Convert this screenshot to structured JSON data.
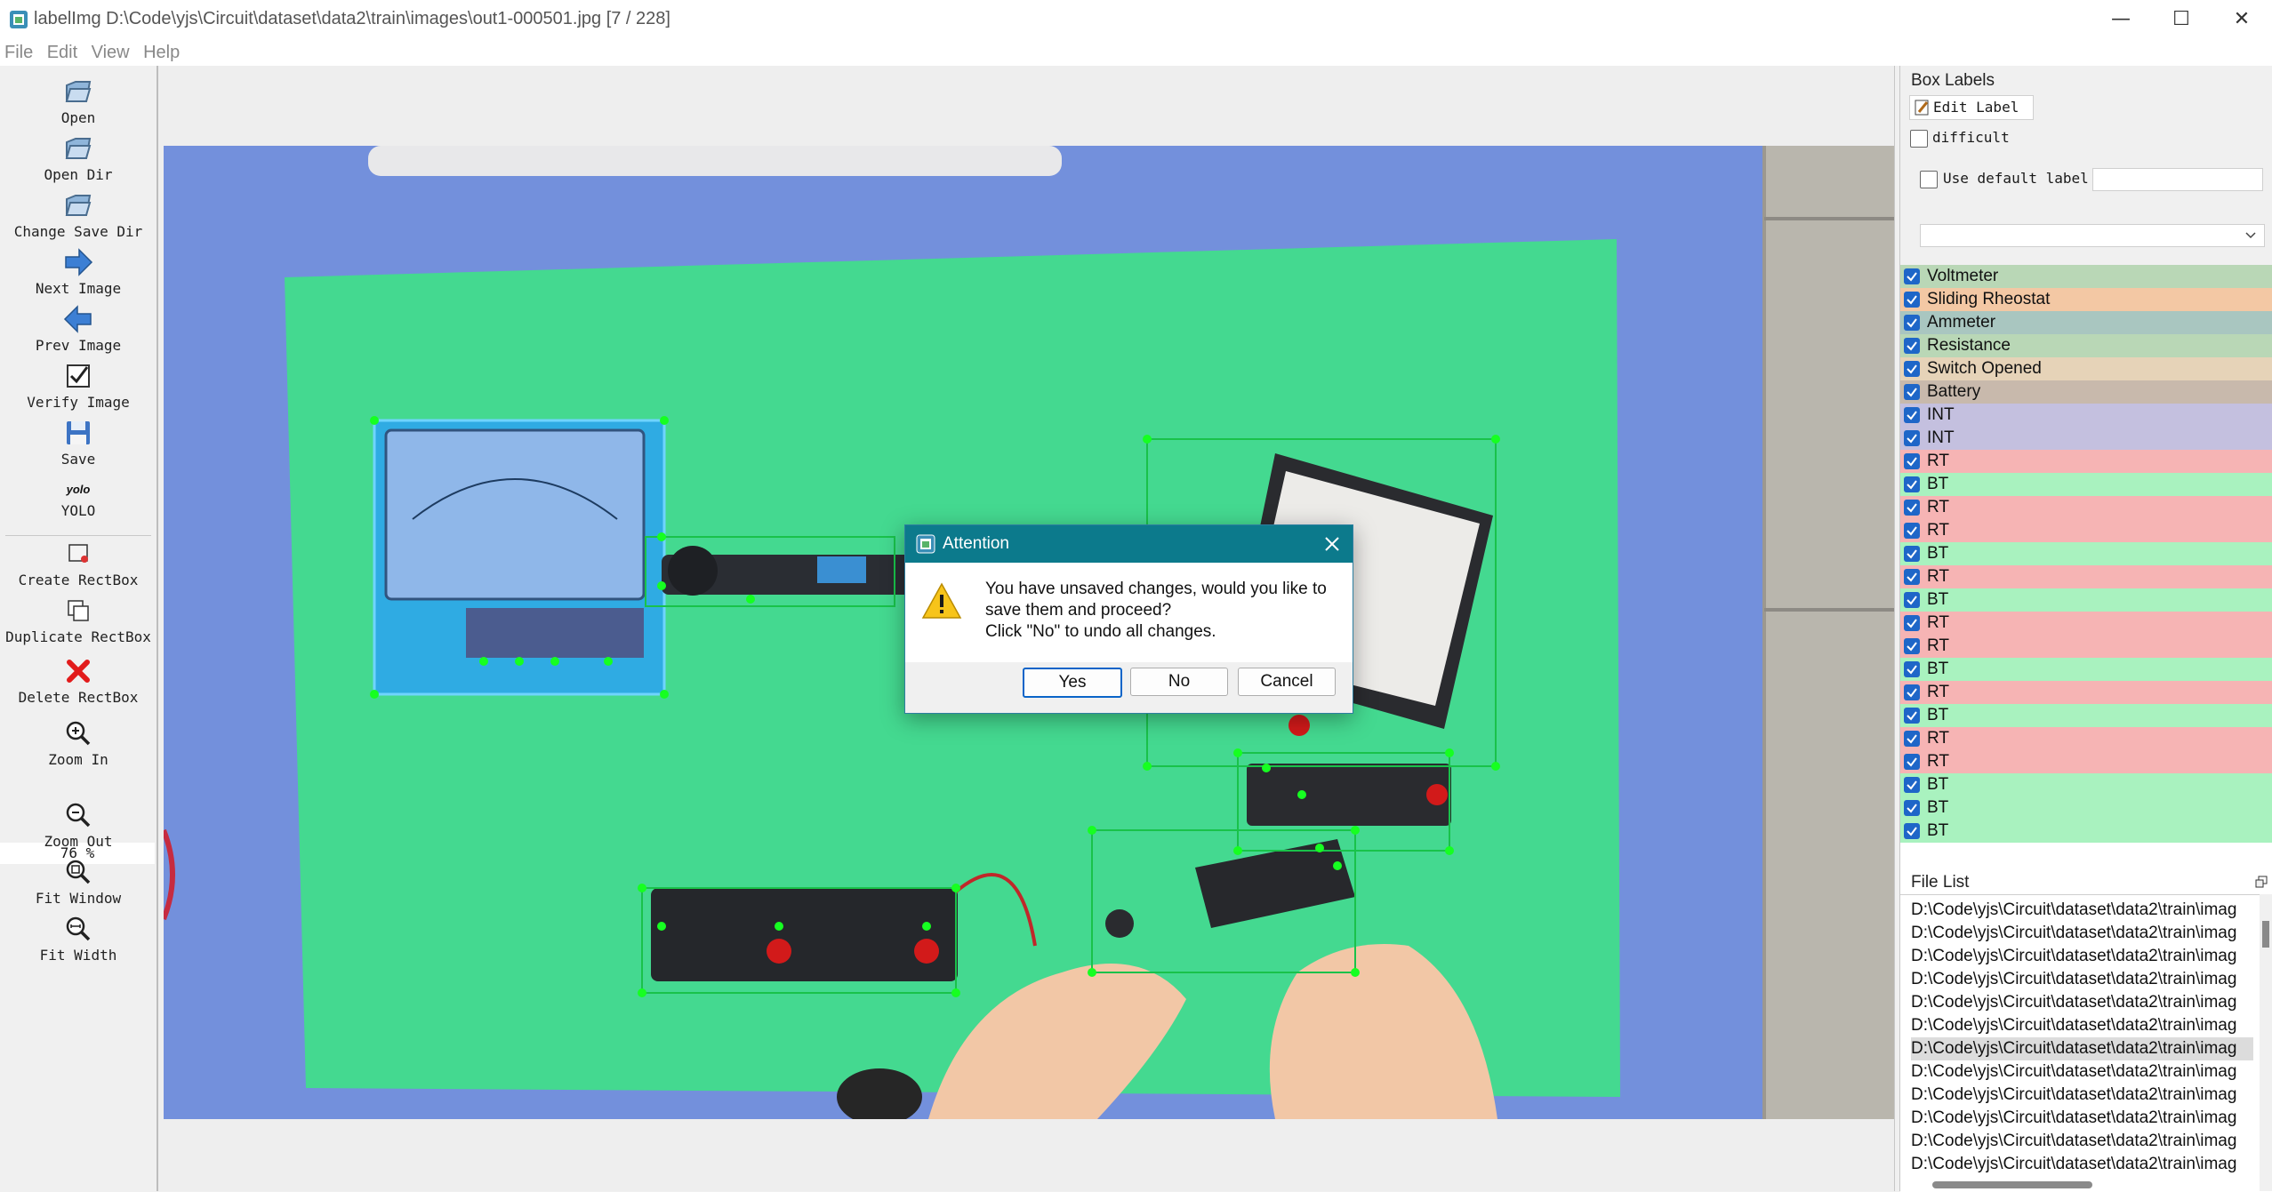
{
  "window": {
    "title": "labelImg D:\\Code\\yjs\\Circuit\\dataset\\data2\\train\\images\\out1-000501.jpg [7 / 228]",
    "minimize": "—",
    "maximize": "☐",
    "close": "✕"
  },
  "menu": [
    "File",
    "Edit",
    "View",
    "Help"
  ],
  "toolbar": {
    "open": "Open",
    "open_dir": "Open Dir",
    "change_save_dir": "Change Save Dir",
    "next_image": "Next Image",
    "prev_image": "Prev Image",
    "verify_image": "Verify Image",
    "save": "Save",
    "yolo_icon_text": "yolo",
    "yolo": "YOLO",
    "create_rectbox": "Create RectBox",
    "duplicate_rectbox": "Duplicate RectBox",
    "delete_rectbox": "Delete RectBox",
    "zoom_in": "Zoom In",
    "zoom_value": "76 %",
    "zoom_out": "Zoom Out",
    "fit_window": "Fit Window",
    "fit_width": "Fit Width"
  },
  "box_labels": {
    "title": "Box Labels",
    "edit_label": "Edit Label",
    "difficult": "difficult",
    "use_default_label": "Use default label",
    "default_label_value": "",
    "dropdown_value": "",
    "items": [
      {
        "label": "Voltmeter",
        "color": "#b9d7b6"
      },
      {
        "label": "Sliding Rheostat",
        "color": "#f3c8a4"
      },
      {
        "label": "Ammeter",
        "color": "#a9c6c0"
      },
      {
        "label": "Resistance",
        "color": "#b9d7b6"
      },
      {
        "label": "Switch Opened",
        "color": "#e6d3b8"
      },
      {
        "label": "Battery",
        "color": "#c8b9ac"
      },
      {
        "label": "INT",
        "color": "#c4c0df"
      },
      {
        "label": "INT",
        "color": "#c4c0df"
      },
      {
        "label": "RT",
        "color": "#f6b4b4"
      },
      {
        "label": "BT",
        "color": "#a9f2bf"
      },
      {
        "label": "RT",
        "color": "#f6b4b4"
      },
      {
        "label": "RT",
        "color": "#f6b4b4"
      },
      {
        "label": "BT",
        "color": "#a9f2bf"
      },
      {
        "label": "RT",
        "color": "#f6b4b4"
      },
      {
        "label": "BT",
        "color": "#a9f2bf"
      },
      {
        "label": "RT",
        "color": "#f6b4b4"
      },
      {
        "label": "RT",
        "color": "#f6b4b4"
      },
      {
        "label": "BT",
        "color": "#a9f2bf"
      },
      {
        "label": "RT",
        "color": "#f6b4b4"
      },
      {
        "label": "BT",
        "color": "#a9f2bf"
      },
      {
        "label": "RT",
        "color": "#f6b4b4"
      },
      {
        "label": "RT",
        "color": "#f6b4b4"
      },
      {
        "label": "BT",
        "color": "#a9f2bf"
      },
      {
        "label": "BT",
        "color": "#a9f2bf"
      },
      {
        "label": "BT",
        "color": "#a9f2bf"
      }
    ]
  },
  "file_list": {
    "title": "File List",
    "items": [
      "D:\\Code\\yjs\\Circuit\\dataset\\data2\\train\\imag",
      "D:\\Code\\yjs\\Circuit\\dataset\\data2\\train\\imag",
      "D:\\Code\\yjs\\Circuit\\dataset\\data2\\train\\imag",
      "D:\\Code\\yjs\\Circuit\\dataset\\data2\\train\\imag",
      "D:\\Code\\yjs\\Circuit\\dataset\\data2\\train\\imag",
      "D:\\Code\\yjs\\Circuit\\dataset\\data2\\train\\imag",
      "D:\\Code\\yjs\\Circuit\\dataset\\data2\\train\\imag",
      "D:\\Code\\yjs\\Circuit\\dataset\\data2\\train\\imag",
      "D:\\Code\\yjs\\Circuit\\dataset\\data2\\train\\imag",
      "D:\\Code\\yjs\\Circuit\\dataset\\data2\\train\\imag",
      "D:\\Code\\yjs\\Circuit\\dataset\\data2\\train\\imag",
      "D:\\Code\\yjs\\Circuit\\dataset\\data2\\train\\imag"
    ],
    "selected_index": 6
  },
  "dialog": {
    "title": "Attention",
    "message_line1": "You have unsaved changes, would you like to",
    "message_line2": "save them and proceed?",
    "message_line3": "Click \"No\" to undo all changes.",
    "yes": "Yes",
    "no": "No",
    "cancel": "Cancel"
  },
  "colors": {
    "dialog_titlebar": "#0c7a8c",
    "checkbox": "#1e66c8",
    "bbox_green": "#00ff00",
    "selected_box": "#3b8ff0"
  }
}
